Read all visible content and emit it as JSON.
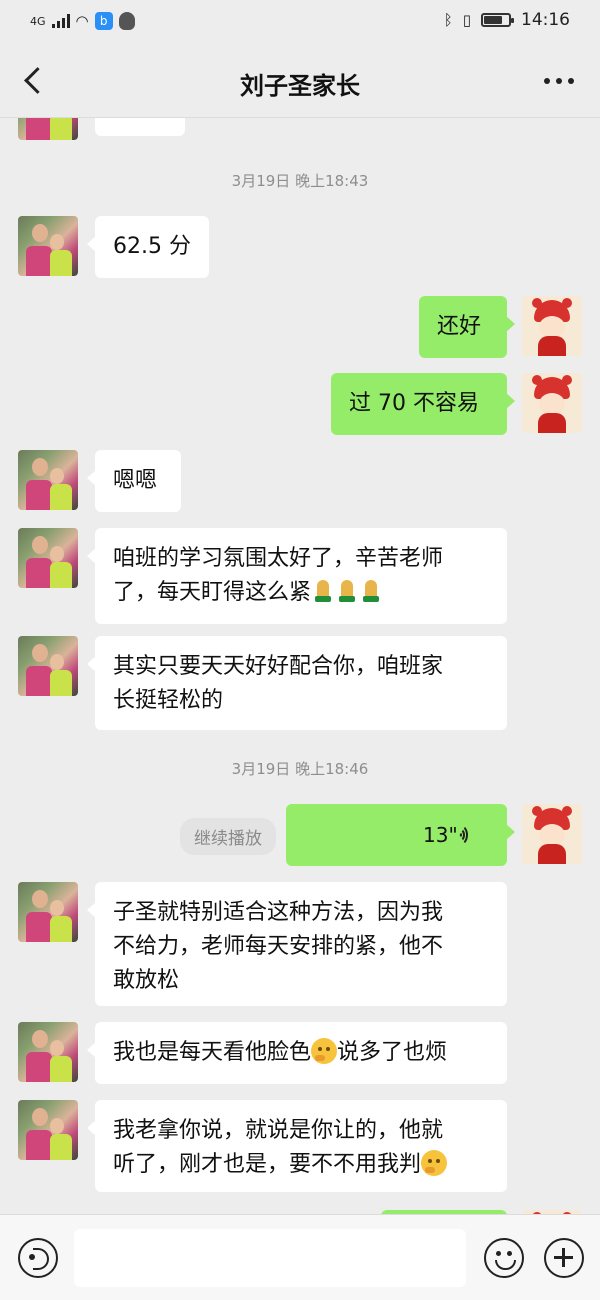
{
  "status_bar": {
    "network": "4G",
    "time": "14:16",
    "battery_level": 0.7
  },
  "nav": {
    "title": "刘子圣家长"
  },
  "timestamps": [
    "3月19日 晚上18:43",
    "3月19日 晚上18:46"
  ],
  "messages": [
    {
      "from": "parent",
      "text": "62.5 分"
    },
    {
      "from": "me",
      "text": "还好"
    },
    {
      "from": "me",
      "text": "过 70 不容易"
    },
    {
      "from": "parent",
      "text": "嗯嗯"
    },
    {
      "from": "parent",
      "line1": "咱班的学习氛围太好了，辛苦老师",
      "line2": "了，每天盯得这么紧"
    },
    {
      "from": "parent",
      "line1": "其实只要天天好好配合你，咱班家",
      "line2": "长挺轻松的"
    },
    {
      "from": "me",
      "type": "voice",
      "duration": "13\"",
      "replay_label": "继续播放"
    },
    {
      "from": "parent",
      "line1": "子圣就特别适合这种方法，因为我",
      "line2": "不给力，老师每天安排的紧，他不",
      "line3": "敢放松"
    },
    {
      "from": "parent",
      "line1a": "我也是每天看他脸色",
      "line1b": "说多了也烦"
    },
    {
      "from": "parent",
      "line1": "我老拿你说，就说是你让的，他就",
      "line2a": "听了，刚才也是，要不不用我判"
    }
  ],
  "icons": {
    "back": "chevron-left-icon",
    "more": "more-dots-icon",
    "voice": "voice-icon",
    "emoji": "emoji-icon",
    "plus": "plus-icon",
    "pray": "pray-emoji-icon",
    "think": "thinking-emoji-icon"
  },
  "colors": {
    "background": "#ededed",
    "bubble_out": "#95ec69",
    "bubble_in": "#ffffff",
    "time": "#8e8e8e"
  }
}
